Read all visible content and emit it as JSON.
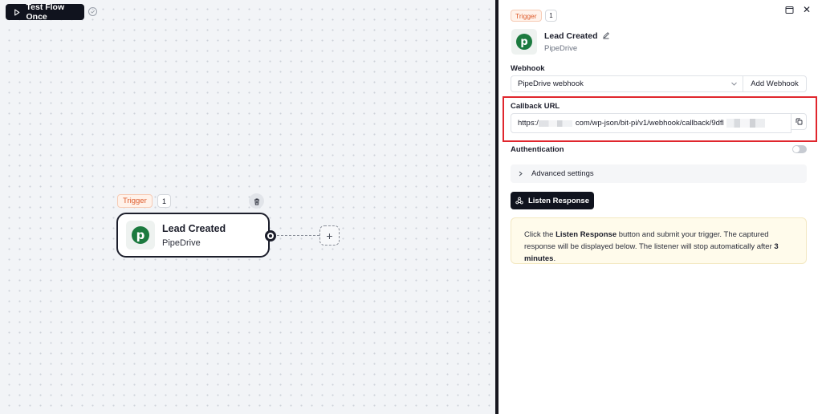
{
  "toolbar": {
    "test_flow_label": "Test Flow Once"
  },
  "node": {
    "badge": "Trigger",
    "count": "1",
    "title": "Lead Created",
    "subtitle": "PipeDrive",
    "logo_letter": "p",
    "add_symbol": "+"
  },
  "panel": {
    "badge": "Trigger",
    "count": "1",
    "title": "Lead Created",
    "subtitle": "PipeDrive",
    "logo_letter": "p",
    "close_symbol": "✕",
    "webhook": {
      "label": "Webhook",
      "selected": "PipeDrive webhook",
      "add_label": "Add Webhook"
    },
    "callback": {
      "label": "Callback URL",
      "url_prefix": "https:/",
      "url_middle": "com/wp-json/bit-pi/v1/webhook/callback/9dfl"
    },
    "authentication": {
      "label": "Authentication",
      "enabled": false
    },
    "advanced_label": "Advanced settings",
    "listen_label": "Listen Response",
    "info": {
      "part1": "Click the ",
      "bold1": "Listen Response",
      "part2": " button and submit your trigger. The captured response will be displayed below. The listener will stop automatically after ",
      "bold2": "3 minutes",
      "part3": "."
    }
  },
  "colors": {
    "dark": "#10131e",
    "trigger_orange": "#dd5a2b",
    "pipedrive_green": "#1c7a3f",
    "highlight_red": "#e0262d",
    "info_bg": "#fffbeb"
  },
  "icons": [
    "play-icon",
    "check-circle-icon",
    "trash-icon",
    "pipedrive-logo-icon",
    "maximize-icon",
    "close-icon",
    "edit-icon",
    "chevron-down-icon",
    "copy-icon",
    "chevron-right-icon",
    "webhook-icon"
  ]
}
